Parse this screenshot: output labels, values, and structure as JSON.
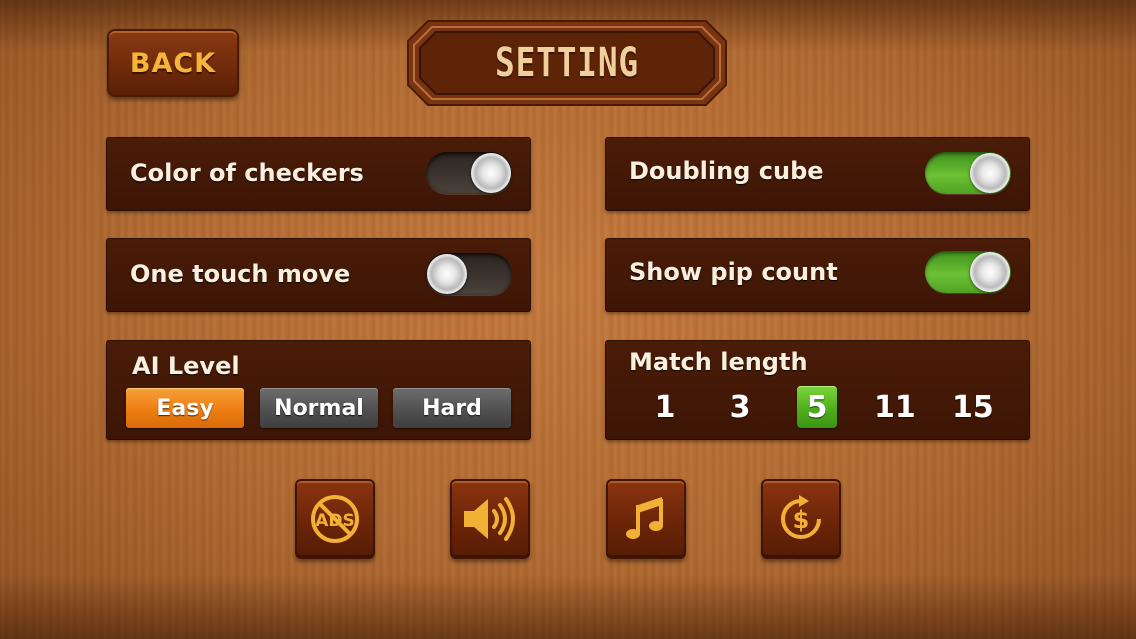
{
  "header": {
    "back_label": "BACK",
    "title": "SETTING"
  },
  "settings": {
    "color_of_checkers": {
      "label": "Color of checkers",
      "state": "off"
    },
    "one_touch_move": {
      "label": "One touch move",
      "state": "off"
    },
    "doubling_cube": {
      "label": "Doubling cube",
      "state": "on"
    },
    "show_pip_count": {
      "label": "Show pip count",
      "state": "on"
    }
  },
  "ai_level": {
    "label": "AI Level",
    "options": [
      "Easy",
      "Normal",
      "Hard"
    ],
    "selected": "Easy"
  },
  "match_length": {
    "label": "Match length",
    "options": [
      "1",
      "3",
      "5",
      "11",
      "15"
    ],
    "selected": "5"
  },
  "bottom_icons": [
    "no-ads-icon",
    "sound-icon",
    "music-icon",
    "restore-purchase-icon"
  ],
  "colors": {
    "accent_orange": "#ee7d12",
    "toggle_green": "#6cc234",
    "back_text": "#f7b43a",
    "icon_gold": "#f2b035"
  }
}
